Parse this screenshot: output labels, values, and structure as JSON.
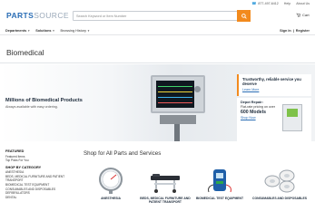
{
  "topbar": {
    "phone": "877-497-6412",
    "help": "Help",
    "about": "About Us"
  },
  "header": {
    "logo_bold": "PARTS",
    "logo_light": "SOURCE",
    "search_placeholder": "Search Keyword or Item Number",
    "cart_label": "Cart"
  },
  "nav": {
    "departments": "Departments",
    "solutions": "Solutions",
    "browsing_history": "Browsing History",
    "sign_in": "Sign In",
    "separator": "|",
    "register": "Register"
  },
  "page": {
    "title": "Biomedical"
  },
  "hero": {
    "title": "Millions of Biomedical Products",
    "subtitle": "Always available with easy ordering.",
    "tagline_title": "Trustworthy, reliable service you deserve",
    "tagline_link": "Learn More",
    "promo_label": "Depot Repair:",
    "promo_line": "Flat-rate pricing on over",
    "promo_count": "600 Models",
    "promo_link": "Shop Now"
  },
  "sidebar": {
    "featured_heading": "FEATURED",
    "featured_items": [
      "Featured Items",
      "Top Picks For You"
    ],
    "category_heading": "SHOP BY CATEGORY",
    "categories": [
      "ANESTHESIA",
      "BEDS, MEDICAL FURNITURE AND PATIENT TRANSPORT",
      "BIOMEDICAL TEST EQUIPMENT",
      "CONSUMABLES AND DISPOSABLES",
      "DEFIBRILLATORS",
      "DENTAL"
    ]
  },
  "main": {
    "shop_title": "Shop for All Parts and Services",
    "tiles": [
      {
        "label": "ANESTHESIA",
        "icon": "gauge-icon"
      },
      {
        "label": "BEDS, MEDICAL FURNITURE AND PATIENT TRANSPORT",
        "icon": "stretcher-icon"
      },
      {
        "label": "BIOMEDICAL TEST EQUIPMENT",
        "icon": "tester-icon"
      },
      {
        "label": "CONSUMABLES AND DISPOSABLES",
        "icon": "tape-rolls-icon"
      }
    ]
  },
  "colors": {
    "accent": "#f28a1d",
    "brand": "#2a6db5"
  }
}
